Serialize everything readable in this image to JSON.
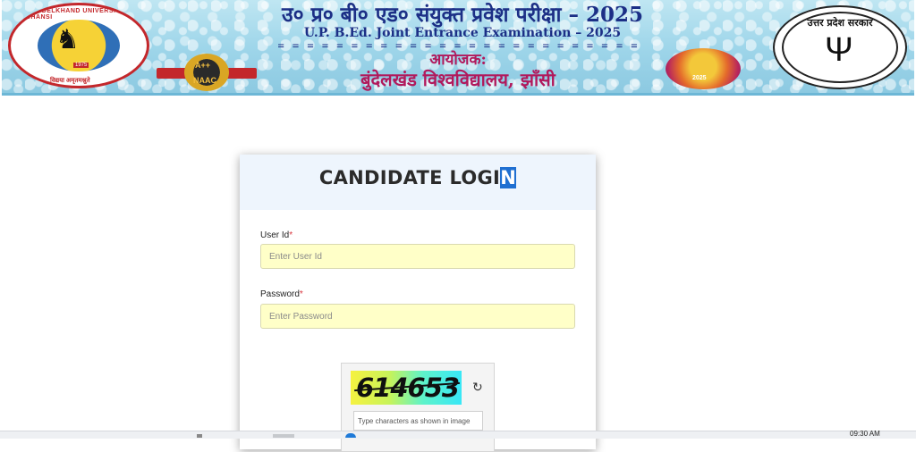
{
  "header": {
    "title_hindi": "उ० प्र० बी० एड० संयुक्त प्रवेश परीक्षा – 2025",
    "title_english": "U.P. B.Ed. Joint Entrance Examination – 2025",
    "divider": "= = = = = = = = = = = = = = = = = = = = = = = = =",
    "organizer_label": "आयोजक:",
    "university_name": "बुंदेलखंड विश्वविद्यालय, झाँसी",
    "left_logo": {
      "ring_text": "BUNDELKHAND UNIVERSITY, JHANSI",
      "year": "1975",
      "motto": "विद्यया अमृतमश्नुते",
      "icon": "university-emblem"
    },
    "naac_badge": {
      "grade": "A++",
      "label": "NAAC"
    },
    "event_badge": {
      "year": "2025"
    },
    "right_logo": {
      "arc_text": "उत्तर प्रदेश सरकार",
      "icon": "up-govt-emblem"
    }
  },
  "login": {
    "title_main": "CANDIDATE LOGI",
    "title_highlight": "N",
    "user_id": {
      "label": "User Id",
      "required_mark": "*",
      "placeholder": "Enter User Id",
      "value": ""
    },
    "password": {
      "label": "Password",
      "required_mark": "*",
      "placeholder": "Enter Password",
      "value": ""
    },
    "captcha": {
      "code": "614653",
      "input_placeholder": "Type characters as shown in image",
      "refresh_icon": "refresh-icon"
    }
  },
  "taskbar": {
    "time": "09:30 AM"
  },
  "colors": {
    "title_blue": "#1c2f86",
    "university_magenta": "#b1195c",
    "input_bg": "#ffffc8",
    "card_header_bg": "#eef5fd",
    "highlight": "#1f6fd1",
    "required": "#d9363e"
  }
}
